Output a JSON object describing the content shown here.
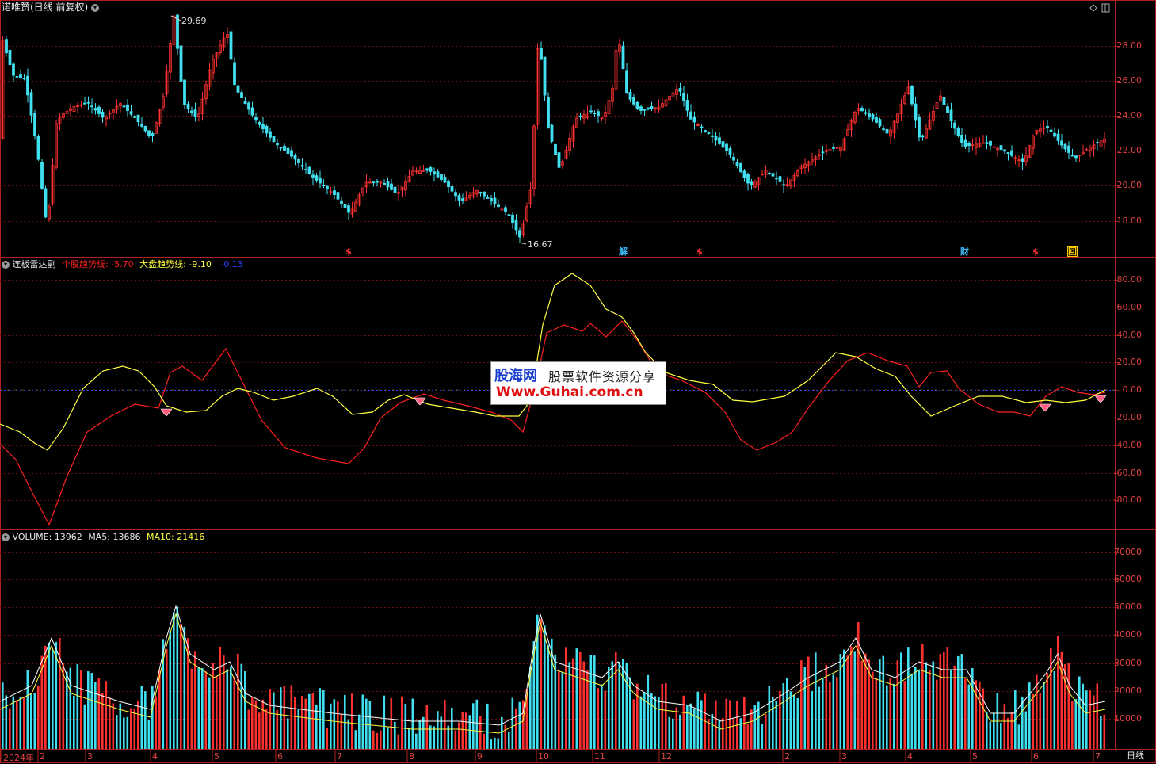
{
  "stock": {
    "title": "诺唯赞(日线 前复权)",
    "high_label": "29.69",
    "low_label": "16.67",
    "price_axis": [
      "28.00",
      "26.00",
      "24.00",
      "22.00",
      "20.00",
      "18.00"
    ],
    "markers": [
      {
        "text": "$",
        "color": "#ff3030"
      },
      {
        "text": "解",
        "color": "#40c0ff"
      },
      {
        "text": "$",
        "color": "#ff3030"
      },
      {
        "text": "财",
        "color": "#40c0ff"
      },
      {
        "text": "$",
        "color": "#ff3030"
      },
      {
        "text": "回",
        "color": "#ffcc00"
      }
    ]
  },
  "indicator": {
    "name": "连板雷达副",
    "line1_label": "个股趋势线: -5.70",
    "line2_label": "大盘趋势线: -9.10",
    "line3_label": "-0.13",
    "axis": [
      "80.00",
      "60.00",
      "40.00",
      "20.00",
      "0.00",
      "-20.00",
      "-40.00",
      "-60.00",
      "-80.00"
    ],
    "colors": {
      "stock_line": "#ff2020",
      "market_line": "#ffff40",
      "zero_line": "#3040ff"
    }
  },
  "volume": {
    "label": "VOLUME: 13962",
    "ma5_label": "MA5: 13686",
    "ma10_label": "MA10: 21416",
    "axis": [
      "70000",
      "60000",
      "50000",
      "40000",
      "30000",
      "20000",
      "10000"
    ]
  },
  "x_axis": {
    "labels": [
      "2024年",
      "2",
      "3",
      "4",
      "5",
      "6",
      "7",
      "8",
      "9",
      "10",
      "11",
      "12",
      "2",
      "3",
      "4",
      "5",
      "6",
      "7"
    ],
    "period": "日线"
  },
  "watermark": {
    "brand": "股海网",
    "slogan": "股票软件资源分享",
    "url": "Www.Guhai.com.cn"
  }
}
